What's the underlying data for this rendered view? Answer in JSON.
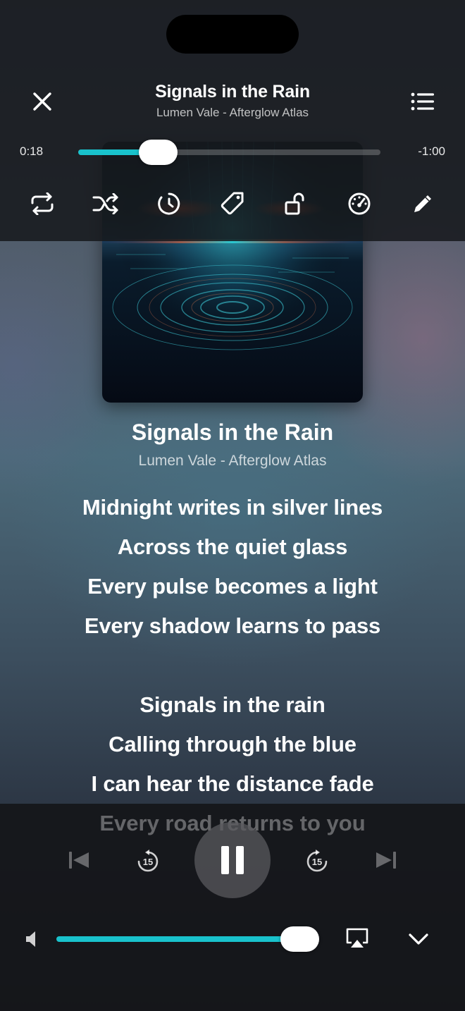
{
  "header": {
    "title": "Signals in the Rain",
    "subtitle": "Lumen Vale - Afterglow Atlas"
  },
  "playback": {
    "elapsed": "0:18",
    "remaining": "-1:00",
    "progress_fraction": 0.23
  },
  "toolbar": {
    "icons": [
      "repeat-icon",
      "shuffle-icon",
      "sleep-timer-icon",
      "tag-icon",
      "unlock-icon",
      "speed-gauge-icon",
      "edit-icon"
    ]
  },
  "now_playing": {
    "title": "Signals in the Rain",
    "subtitle": "Lumen Vale - Afterglow Atlas"
  },
  "lyrics": {
    "lines": [
      "Midnight writes in silver lines",
      "Across the quiet glass",
      "Every pulse becomes a light",
      "Every shadow learns to pass",
      "",
      "Signals in the rain",
      "Calling through the blue",
      "I can hear the distance fade",
      "Every road returns to you"
    ]
  },
  "controls": {
    "skip_back_seconds": "15",
    "skip_forward_seconds": "15"
  },
  "volume": {
    "level_fraction": 0.95
  },
  "colors": {
    "accent": "#19c2cc"
  }
}
